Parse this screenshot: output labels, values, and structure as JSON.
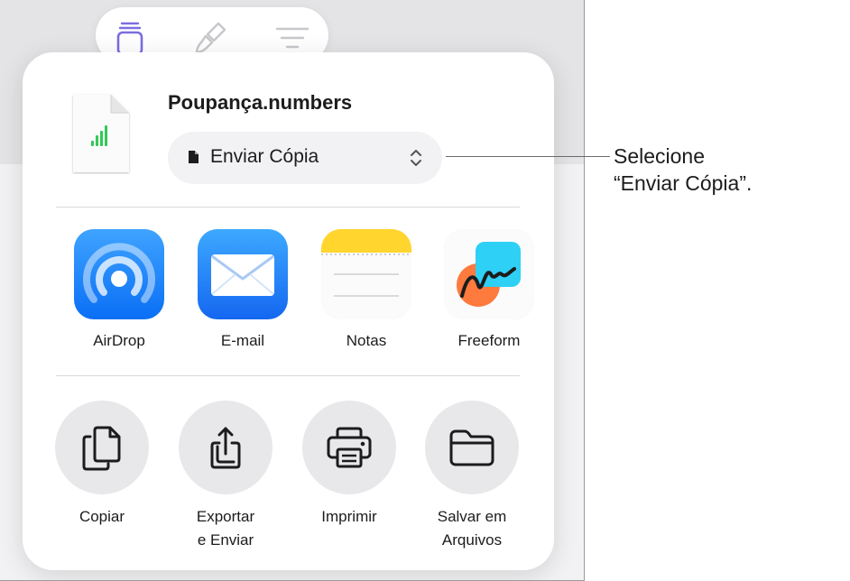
{
  "toolbar": {
    "buttons": [
      {
        "icon": "format-object-icon",
        "selected": true
      },
      {
        "icon": "brush-icon",
        "selected": false
      },
      {
        "icon": "text-align-icon",
        "selected": false
      }
    ]
  },
  "document": {
    "file_name": "Poupança.numbers",
    "icon": "numbers-document-icon",
    "mode_select": {
      "value": "Enviar Cópia",
      "icon": "document-icon",
      "chevron": "chevron-up-down-icon"
    }
  },
  "apps": [
    {
      "label": "AirDrop",
      "icon": "airdrop-icon"
    },
    {
      "label": "E-mail",
      "icon": "mail-icon"
    },
    {
      "label": "Notas",
      "icon": "notes-icon"
    },
    {
      "label": "Freeform",
      "icon": "freeform-icon"
    }
  ],
  "actions": [
    {
      "line1": "Copiar",
      "line2": "",
      "icon": "copy-icon"
    },
    {
      "line1": "Exportar",
      "line2": "e Enviar",
      "icon": "export-share-icon"
    },
    {
      "line1": "Imprimir",
      "line2": "",
      "icon": "printer-icon"
    },
    {
      "line1": "Salvar em",
      "line2": "Arquivos",
      "icon": "folder-icon"
    }
  ],
  "callout": {
    "line1": "Selecione",
    "line2": "“Enviar Cópia”."
  },
  "colors": {
    "accent_purple": "#7b6ee0",
    "numbers_green": "#34c759",
    "airdrop_blue": "#1a8cff",
    "mail_blue": "#1f7bff",
    "notes_yellow": "#ffd52e"
  }
}
